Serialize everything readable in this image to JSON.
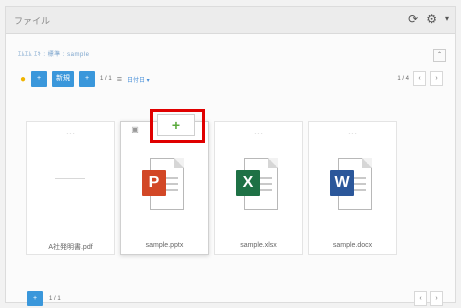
{
  "window": {
    "title": "ファイル"
  },
  "header_icons": [
    "refresh-icon",
    "gear-icon",
    "caret-down-icon"
  ],
  "breadcrumb": "ｴﾑｴﾑ ｴｷ : 標準 : sample",
  "toolbar": {
    "add_label": "+",
    "new_label": "新規",
    "extra_label": "+",
    "page_label": "1 / 1",
    "sort_label": "日付日 ▾",
    "view_icon": "≡",
    "count_label": "1 / 4"
  },
  "files": [
    {
      "name": "A社発明書.pdf",
      "type": "pdf",
      "thumb_text": "- - -"
    },
    {
      "name": "sample.pptx",
      "type": "pptx",
      "badge": "P",
      "color": "#d24726",
      "thumb_text": "- - -"
    },
    {
      "name": "sample.xlsx",
      "type": "xlsx",
      "badge": "X",
      "color": "#1e7145",
      "thumb_text": "- - -"
    },
    {
      "name": "sample.docx",
      "type": "docx",
      "badge": "W",
      "color": "#2b579a",
      "thumb_text": "- - -"
    }
  ],
  "card_actions": {
    "grey_icon": "▣",
    "add": "+"
  },
  "footer": {
    "upload_label": "+",
    "page_label": "1 / 1"
  },
  "pager": {
    "prev": "‹",
    "next": "›"
  },
  "colors": {
    "accent": "#3a97db",
    "highlight": "#e00000",
    "add_green": "#5aaa3c"
  }
}
